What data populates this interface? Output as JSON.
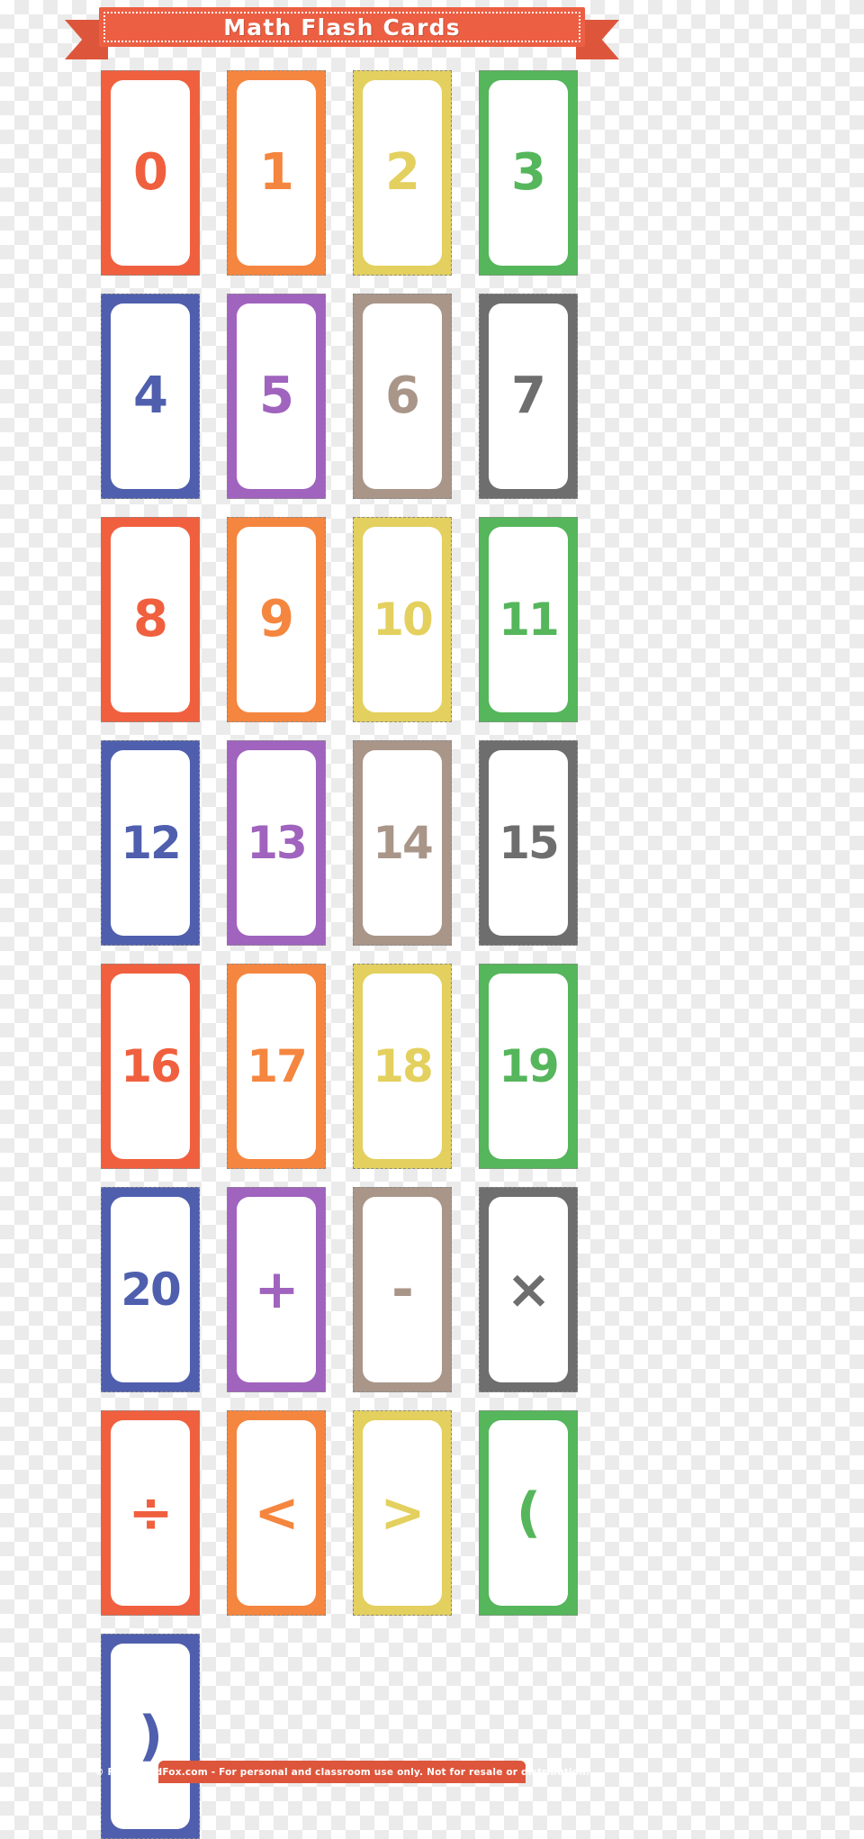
{
  "banner": {
    "title": "Math Flash Cards",
    "background_color": "#EC5F43",
    "tail_color": "#DD563C",
    "text_color": "#FFFFFF"
  },
  "footer": {
    "text": "© FlashCardFox.com - For personal and classroom use only. Not for resale or distribution.",
    "background_color": "#DD563C",
    "text_color": "#FFFFFF"
  },
  "palette": {
    "tomato": "#F0603F",
    "orange": "#F5863F",
    "yellow": "#E3D05E",
    "green": "#55B65B",
    "blue": "#4F5FAE",
    "purple": "#A063BE",
    "taupe": "#A99689",
    "gray": "#6E6E6E"
  },
  "grid": {
    "columns": 4,
    "card_count": 29,
    "card_inner_color": "#FFFFFF"
  },
  "cards": [
    {
      "label": "0",
      "color": "#F0603F",
      "kind": "number"
    },
    {
      "label": "1",
      "color": "#F5863F",
      "kind": "number"
    },
    {
      "label": "2",
      "color": "#E3D05E",
      "kind": "number"
    },
    {
      "label": "3",
      "color": "#55B65B",
      "kind": "number"
    },
    {
      "label": "4",
      "color": "#4F5FAE",
      "kind": "number"
    },
    {
      "label": "5",
      "color": "#A063BE",
      "kind": "number"
    },
    {
      "label": "6",
      "color": "#A99689",
      "kind": "number"
    },
    {
      "label": "7",
      "color": "#6E6E6E",
      "kind": "number"
    },
    {
      "label": "8",
      "color": "#F0603F",
      "kind": "number"
    },
    {
      "label": "9",
      "color": "#F5863F",
      "kind": "number"
    },
    {
      "label": "10",
      "color": "#E3D05E",
      "kind": "number"
    },
    {
      "label": "11",
      "color": "#55B65B",
      "kind": "number"
    },
    {
      "label": "12",
      "color": "#4F5FAE",
      "kind": "number"
    },
    {
      "label": "13",
      "color": "#A063BE",
      "kind": "number"
    },
    {
      "label": "14",
      "color": "#A99689",
      "kind": "number"
    },
    {
      "label": "15",
      "color": "#6E6E6E",
      "kind": "number"
    },
    {
      "label": "16",
      "color": "#F0603F",
      "kind": "number"
    },
    {
      "label": "17",
      "color": "#F5863F",
      "kind": "number"
    },
    {
      "label": "18",
      "color": "#E3D05E",
      "kind": "number"
    },
    {
      "label": "19",
      "color": "#55B65B",
      "kind": "number"
    },
    {
      "label": "20",
      "color": "#4F5FAE",
      "kind": "number"
    },
    {
      "label": "+",
      "color": "#A063BE",
      "kind": "symbol"
    },
    {
      "label": "-",
      "color": "#A99689",
      "kind": "symbol"
    },
    {
      "label": "×",
      "color": "#6E6E6E",
      "kind": "symbol"
    },
    {
      "label": "÷",
      "color": "#F0603F",
      "kind": "symbol"
    },
    {
      "label": "<",
      "color": "#F5863F",
      "kind": "symbol"
    },
    {
      "label": ">",
      "color": "#E3D05E",
      "kind": "symbol"
    },
    {
      "label": "(",
      "color": "#55B65B",
      "kind": "symbol"
    },
    {
      "label": ")",
      "color": "#4F5FAE",
      "kind": "symbol"
    }
  ]
}
